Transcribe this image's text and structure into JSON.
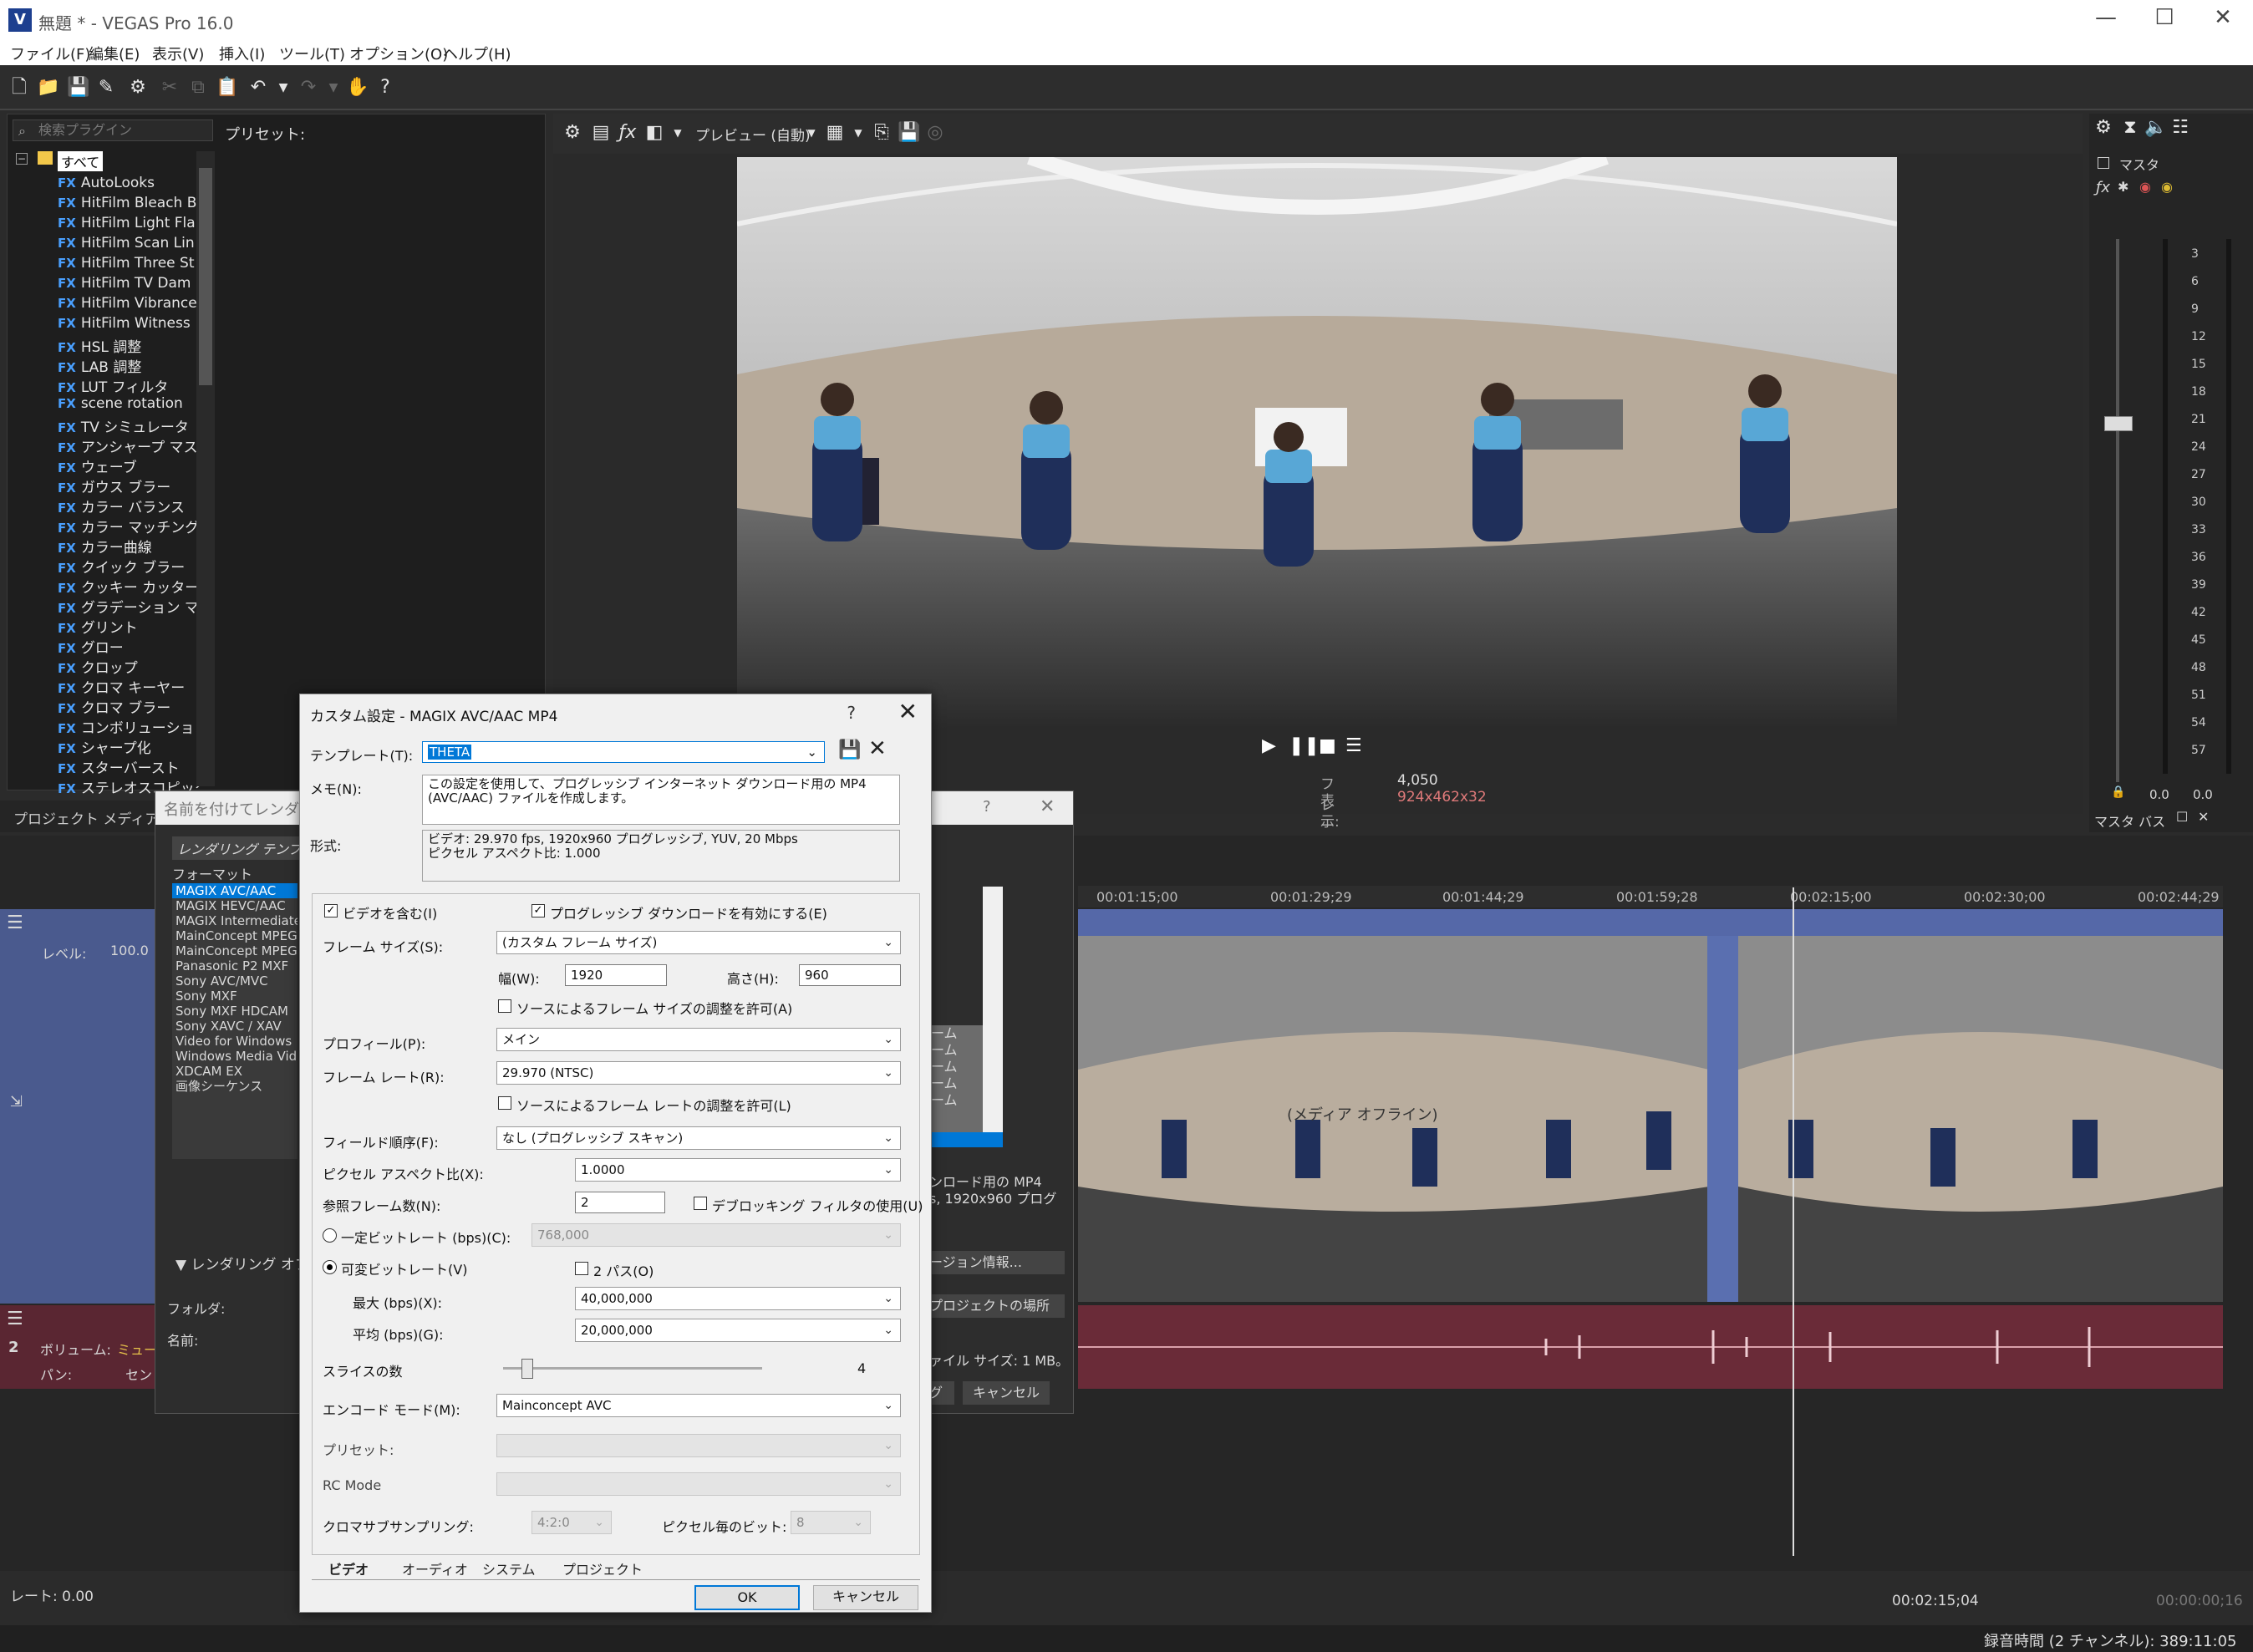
{
  "window": {
    "title": "無題 * - VEGAS Pro 16.0",
    "logo": "V",
    "controls": [
      "—",
      "☐",
      "✕"
    ]
  },
  "menu": [
    "ファイル(F)",
    "編集(E)",
    "表示(V)",
    "挿入(I)",
    "ツール(T)",
    "オプション(O)",
    "ヘルプ(H)"
  ],
  "plugins": {
    "search_placeholder": "検索プラグイン",
    "preset_label": "プリセット:",
    "root": "すべて",
    "items": [
      "AutoLooks",
      "HitFilm Bleach B",
      "HitFilm Light Fla",
      "HitFilm Scan Lin",
      "HitFilm Three St",
      "HitFilm TV Dam",
      "HitFilm Vibrance",
      "HitFilm Witness",
      "HSL 調整",
      "LAB 調整",
      "LUT フィルタ",
      "scene rotation",
      "TV シミュレータ",
      "アンシャープ マスク",
      "ウェーブ",
      "ガウス ブラー",
      "カラー バランス",
      "カラー マッチング",
      "カラー曲線",
      "クイック ブラー",
      "クッキー カッター",
      "グラデーション マップ",
      "グリント",
      "グロー",
      "クロップ",
      "クロマ キーヤー",
      "クロマ ブラー",
      "コンボリューション フ",
      "シャープ化",
      "スターバースト",
      "ステレオスコピック"
    ],
    "fx_tag": "FX",
    "bottom_tab": "プロジェクト メディア"
  },
  "preview": {
    "mode": "プレビュー (自動)",
    "frame_label": "フレーム:",
    "frame_value": "4,050",
    "display_label": "表示:",
    "display_value": "924x462x32"
  },
  "mixer": {
    "title": "マスタ",
    "scale": [
      "3",
      "6",
      "9",
      "12",
      "15",
      "18",
      "21",
      "24",
      "27",
      "30",
      "33",
      "36",
      "39",
      "42",
      "45",
      "48",
      "51",
      "54",
      "57"
    ],
    "left_value": "0.0",
    "right_value": "0.0",
    "bus_label": "マスタ バス"
  },
  "timeline": {
    "ruler": [
      "00:01:15;00",
      "00:01:29;29",
      "00:01:44;29",
      "00:01:59;28",
      "00:02:15;00",
      "00:02:30;00",
      "00:02:44;29"
    ],
    "video_track": {
      "level_label": "レベル:",
      "level_value": "100.0"
    },
    "audio_track": {
      "volume_label": "ボリューム:",
      "volume_value": "ミュー",
      "pan_label": "パン:",
      "pan_value": "セン"
    },
    "rate": "レート: 0.00",
    "timecode": "00:02:15;04",
    "end_timecode": "00:00:00;16",
    "overlay_text": "(メディア オフライン)"
  },
  "status": "録音時間 (2 チャンネル): 389:11:05",
  "bg_dialog": {
    "title": "名前を付けてレンダリング",
    "format_header": "レンダリング テンプレ",
    "format_label": "フォーマット",
    "formats": [
      "MAGIX AVC/AAC",
      "MAGIX HEVC/AAC",
      "MAGIX Intermediate",
      "MainConcept MPEG",
      "MainConcept MPEG",
      "Panasonic P2 MXF",
      "Sony AVC/MVC",
      "Sony MXF",
      "Sony MXF HDCAM",
      "Sony XAVC / XAV",
      "Video for Windows",
      "Windows Media Vid",
      "XDCAM EX",
      "画像シーケンス"
    ],
    "right_partial": [
      "ーム",
      "ーム",
      "ーム",
      "ーム",
      "ーム"
    ],
    "desc_partial": "ンロード用の MP4",
    "desc_partial2": "s, 1920x960 プログ",
    "render_options": "レンダリング オプ",
    "folder_label": "フォルダ:",
    "name_label": "名前:",
    "version_btn": "ージョン情報...",
    "project_loc_btn": "プロジェクトの場所",
    "filesize": "ァイル サイズ: 1 MB。",
    "cancel": "キャンセル",
    "render_partial": "グ"
  },
  "dialog": {
    "title": "カスタム設定 - MAGIX AVC/AAC MP4",
    "help": "?",
    "close": "✕",
    "template_label": "テンプレート(T):",
    "template_value": "THETA",
    "memo_label": "メモ(N):",
    "memo_value": "この設定を使用して、プログレッシブ インターネット ダウンロード用の MP4 (AVC/AAC) ファイルを作成します。",
    "format_label": "形式:",
    "format_line1": "ビデオ: 29.970 fps, 1920x960 プログレッシブ, YUV, 20 Mbps",
    "format_line2": "ピクセル アスペクト比: 1.000",
    "include_video": "ビデオを含む(I)",
    "progressive_dl": "プログレッシブ ダウンロードを有効にする(E)",
    "frame_size_label": "フレーム サイズ(S):",
    "frame_size_value": "(カスタム フレーム サイズ)",
    "width_label": "幅(W):",
    "width_value": "1920",
    "height_label": "高さ(H):",
    "height_value": "960",
    "allow_frame_size": "ソースによるフレーム サイズの調整を許可(A)",
    "profile_label": "プロフィール(P):",
    "profile_value": "メイン",
    "frame_rate_label": "フレーム レート(R):",
    "frame_rate_value": "29.970 (NTSC)",
    "allow_frame_rate": "ソースによるフレーム レートの調整を許可(L)",
    "field_order_label": "フィールド順序(F):",
    "field_order_value": "なし (プログレッシブ スキャン)",
    "par_label": "ピクセル アスペクト比(X):",
    "par_value": "1.0000",
    "ref_frames_label": "参照フレーム数(N):",
    "ref_frames_value": "2",
    "deblock": "デブロッキング フィルタの使用(U)",
    "cbr_label": "一定ビットレート (bps)(C):",
    "cbr_value": "768,000",
    "vbr_label": "可変ビットレート(V)",
    "two_pass": "2 パス(O)",
    "max_label": "最大 (bps)(X):",
    "max_value": "40,000,000",
    "avg_label": "平均 (bps)(G):",
    "avg_value": "20,000,000",
    "slices_label": "スライスの数",
    "slices_value": "4",
    "encode_mode_label": "エンコード モード(M):",
    "encode_mode_value": "Mainconcept AVC",
    "preset_label": "プリセット:",
    "rc_mode_label": "RC Mode",
    "chroma_label": "クロマサブサンプリング:",
    "chroma_value": "4:2:0",
    "bits_label": "ピクセル毎のビット:",
    "bits_value": "8",
    "tabs": [
      "ビデオ",
      "オーディオ",
      "システム",
      "プロジェクト"
    ],
    "ok": "OK",
    "cancel": "キャンセル"
  }
}
